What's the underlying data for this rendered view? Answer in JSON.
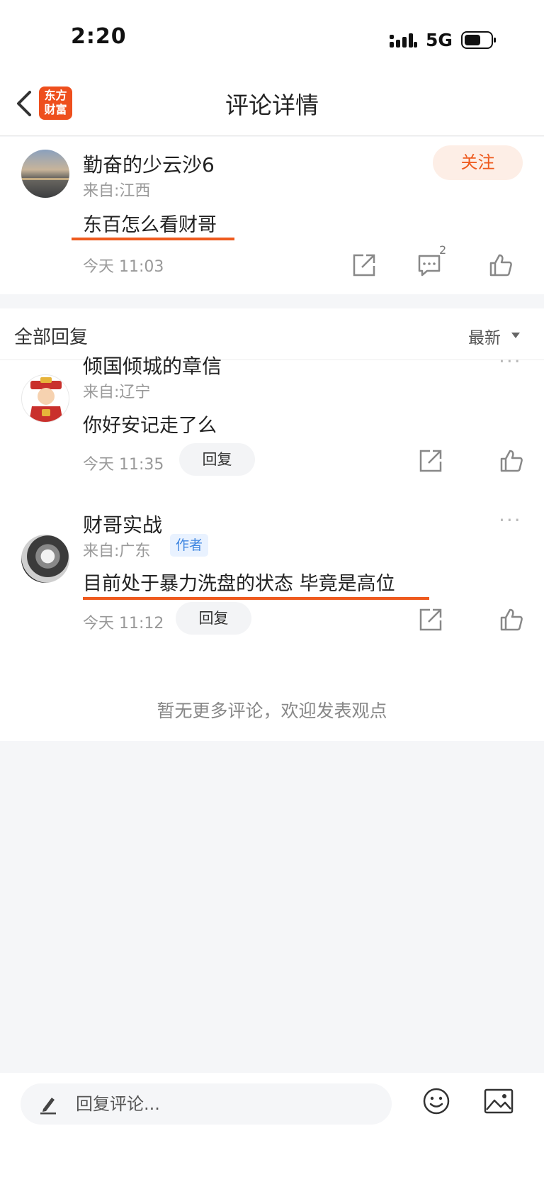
{
  "status_bar": {
    "time": "2:20",
    "network": "5G"
  },
  "header": {
    "logo_line1": "东方",
    "logo_line2": "财富",
    "title": "评论详情"
  },
  "main_comment": {
    "username": "勤奋的少云沙6",
    "location": "来自:江西",
    "follow_label": "关注",
    "content": "东百怎么看财哥",
    "time": "今天 11:03",
    "comment_count": "2"
  },
  "replies": {
    "title": "全部回复",
    "sort_label": "最新",
    "items": [
      {
        "username": "倾国倾城的章信",
        "location": "来自:辽宁",
        "content": "你好安记走了么",
        "time": "今天 11:35",
        "reply_label": "回复"
      },
      {
        "username": "财哥实战",
        "author_tag": "作者",
        "location": "来自:广东",
        "content": "目前处于暴力洗盘的状态 毕竟是高位",
        "time": "今天 11:12",
        "reply_label": "回复"
      }
    ],
    "no_more_text": "暂无更多评论，欢迎发表观点"
  },
  "bottom_bar": {
    "reply_placeholder": "回复评论..."
  },
  "colors": {
    "accent": "#ee5a1e",
    "author_blue": "#3f86e0",
    "background": "#f5f6f8"
  }
}
